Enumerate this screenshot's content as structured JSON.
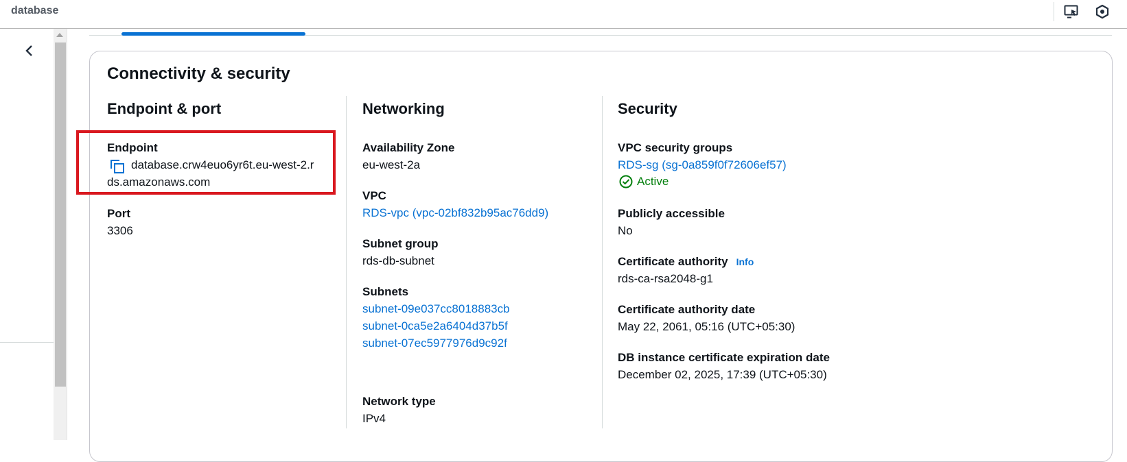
{
  "app": {
    "title": "database"
  },
  "toolbar": {
    "icons": [
      "monitor-cursor-icon",
      "hexagon-settings-icon"
    ]
  },
  "sidebar": {
    "collapse_icon": "chevron-left-icon"
  },
  "section": {
    "title": "Connectivity & security",
    "endpoint_port": {
      "title": "Endpoint & port",
      "endpoint_label": "Endpoint",
      "endpoint_line1": "database.crw4euo6yr6t.eu-west-2.r",
      "endpoint_line2": "ds.amazonaws.com",
      "port_label": "Port",
      "port_value": "3306"
    },
    "networking": {
      "title": "Networking",
      "az_label": "Availability Zone",
      "az_value": "eu-west-2a",
      "vpc_label": "VPC",
      "vpc_value": "RDS-vpc (vpc-02bf832b95ac76dd9)",
      "subnet_group_label": "Subnet group",
      "subnet_group_value": "rds-db-subnet",
      "subnets_label": "Subnets",
      "subnets": [
        "subnet-09e037cc8018883cb",
        "subnet-0ca5e2a6404d37b5f",
        "subnet-07ec5977976d9c92f"
      ],
      "network_type_label": "Network type",
      "network_type_value": "IPv4"
    },
    "security": {
      "title": "Security",
      "vpc_sg_label": "VPC security groups",
      "vpc_sg_value": "RDS-sg (sg-0a859f0f72606ef57)",
      "sg_status": "Active",
      "public_label": "Publicly accessible",
      "public_value": "No",
      "ca_label": "Certificate authority",
      "ca_info": "Info",
      "ca_value": "rds-ca-rsa2048-g1",
      "ca_date_label": "Certificate authority date",
      "ca_date_value": "May 22, 2061, 05:16 (UTC+05:30)",
      "cert_exp_label": "DB instance certificate expiration date",
      "cert_exp_value": "December 02, 2025, 17:39 (UTC+05:30)"
    }
  },
  "colors": {
    "link": "#0972d3",
    "success": "#037f0c",
    "highlight": "#d9181f"
  }
}
